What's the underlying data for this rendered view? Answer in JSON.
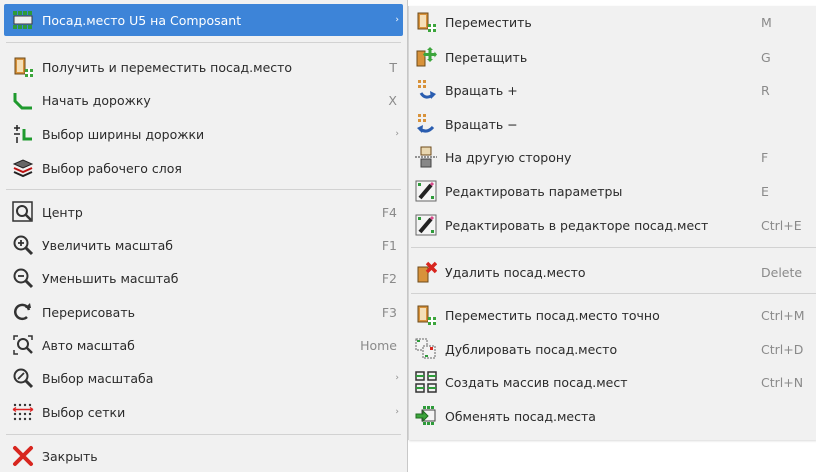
{
  "main_menu": {
    "items": [
      {
        "label": "Посад.место U5 на Composant",
        "shortcut": "",
        "icon": "footprint-icon",
        "arrow": "›"
      },
      {
        "label": "Получить и переместить посад.место",
        "shortcut": "T",
        "icon": "get-move-footprint-icon",
        "arrow": ""
      },
      {
        "label": "Начать дорожку",
        "shortcut": "X",
        "icon": "track-icon",
        "arrow": ""
      },
      {
        "label": "Выбор ширины дорожки",
        "shortcut": "",
        "icon": "track-width-icon",
        "arrow": "›"
      },
      {
        "label": "Выбор рабочего слоя",
        "shortcut": "",
        "icon": "layers-icon",
        "arrow": ""
      },
      {
        "label": "Центр",
        "shortcut": "F4",
        "icon": "zoom-center-icon",
        "arrow": ""
      },
      {
        "label": "Увеличить масштаб",
        "shortcut": "F1",
        "icon": "zoom-in-icon",
        "arrow": ""
      },
      {
        "label": "Уменьшить масштаб",
        "shortcut": "F2",
        "icon": "zoom-out-icon",
        "arrow": ""
      },
      {
        "label": "Перерисовать",
        "shortcut": "F3",
        "icon": "redraw-icon",
        "arrow": ""
      },
      {
        "label": "Авто масштаб",
        "shortcut": "Home",
        "icon": "zoom-fit-icon",
        "arrow": ""
      },
      {
        "label": "Выбор масштаба",
        "shortcut": "",
        "icon": "zoom-select-icon",
        "arrow": "›"
      },
      {
        "label": "Выбор сетки",
        "shortcut": "",
        "icon": "grid-icon",
        "arrow": "›"
      },
      {
        "label": "Закрыть",
        "shortcut": "",
        "icon": "close-icon",
        "arrow": ""
      }
    ]
  },
  "sub_menu": {
    "items": [
      {
        "label": "Переместить",
        "shortcut": "M",
        "icon": "move-icon"
      },
      {
        "label": "Перетащить",
        "shortcut": "G",
        "icon": "drag-icon"
      },
      {
        "label": "Вращать +",
        "shortcut": "R",
        "icon": "rotate-cw-icon"
      },
      {
        "label": "Вращать −",
        "shortcut": "",
        "icon": "rotate-ccw-icon"
      },
      {
        "label": "На другую сторону",
        "shortcut": "F",
        "icon": "flip-icon"
      },
      {
        "label": "Редактировать параметры",
        "shortcut": "E",
        "icon": "edit-params-icon"
      },
      {
        "label": "Редактировать в редакторе посад.мест",
        "shortcut": "Ctrl+E",
        "icon": "edit-in-editor-icon"
      },
      {
        "label": "Удалить посад.место",
        "shortcut": "Delete",
        "icon": "delete-icon"
      },
      {
        "label": "Переместить посад.место точно",
        "shortcut": "Ctrl+M",
        "icon": "move-exact-icon"
      },
      {
        "label": "Дублировать посад.место",
        "shortcut": "Ctrl+D",
        "icon": "duplicate-icon"
      },
      {
        "label": "Создать массив посад.мест",
        "shortcut": "Ctrl+N",
        "icon": "array-icon"
      },
      {
        "label": "Обменять посад.места",
        "shortcut": "",
        "icon": "exchange-icon"
      }
    ]
  },
  "colors": {
    "highlight": "#3d84d8",
    "menu_bg": "#f1f1f1",
    "shortcut_text": "#8a8a8a"
  }
}
